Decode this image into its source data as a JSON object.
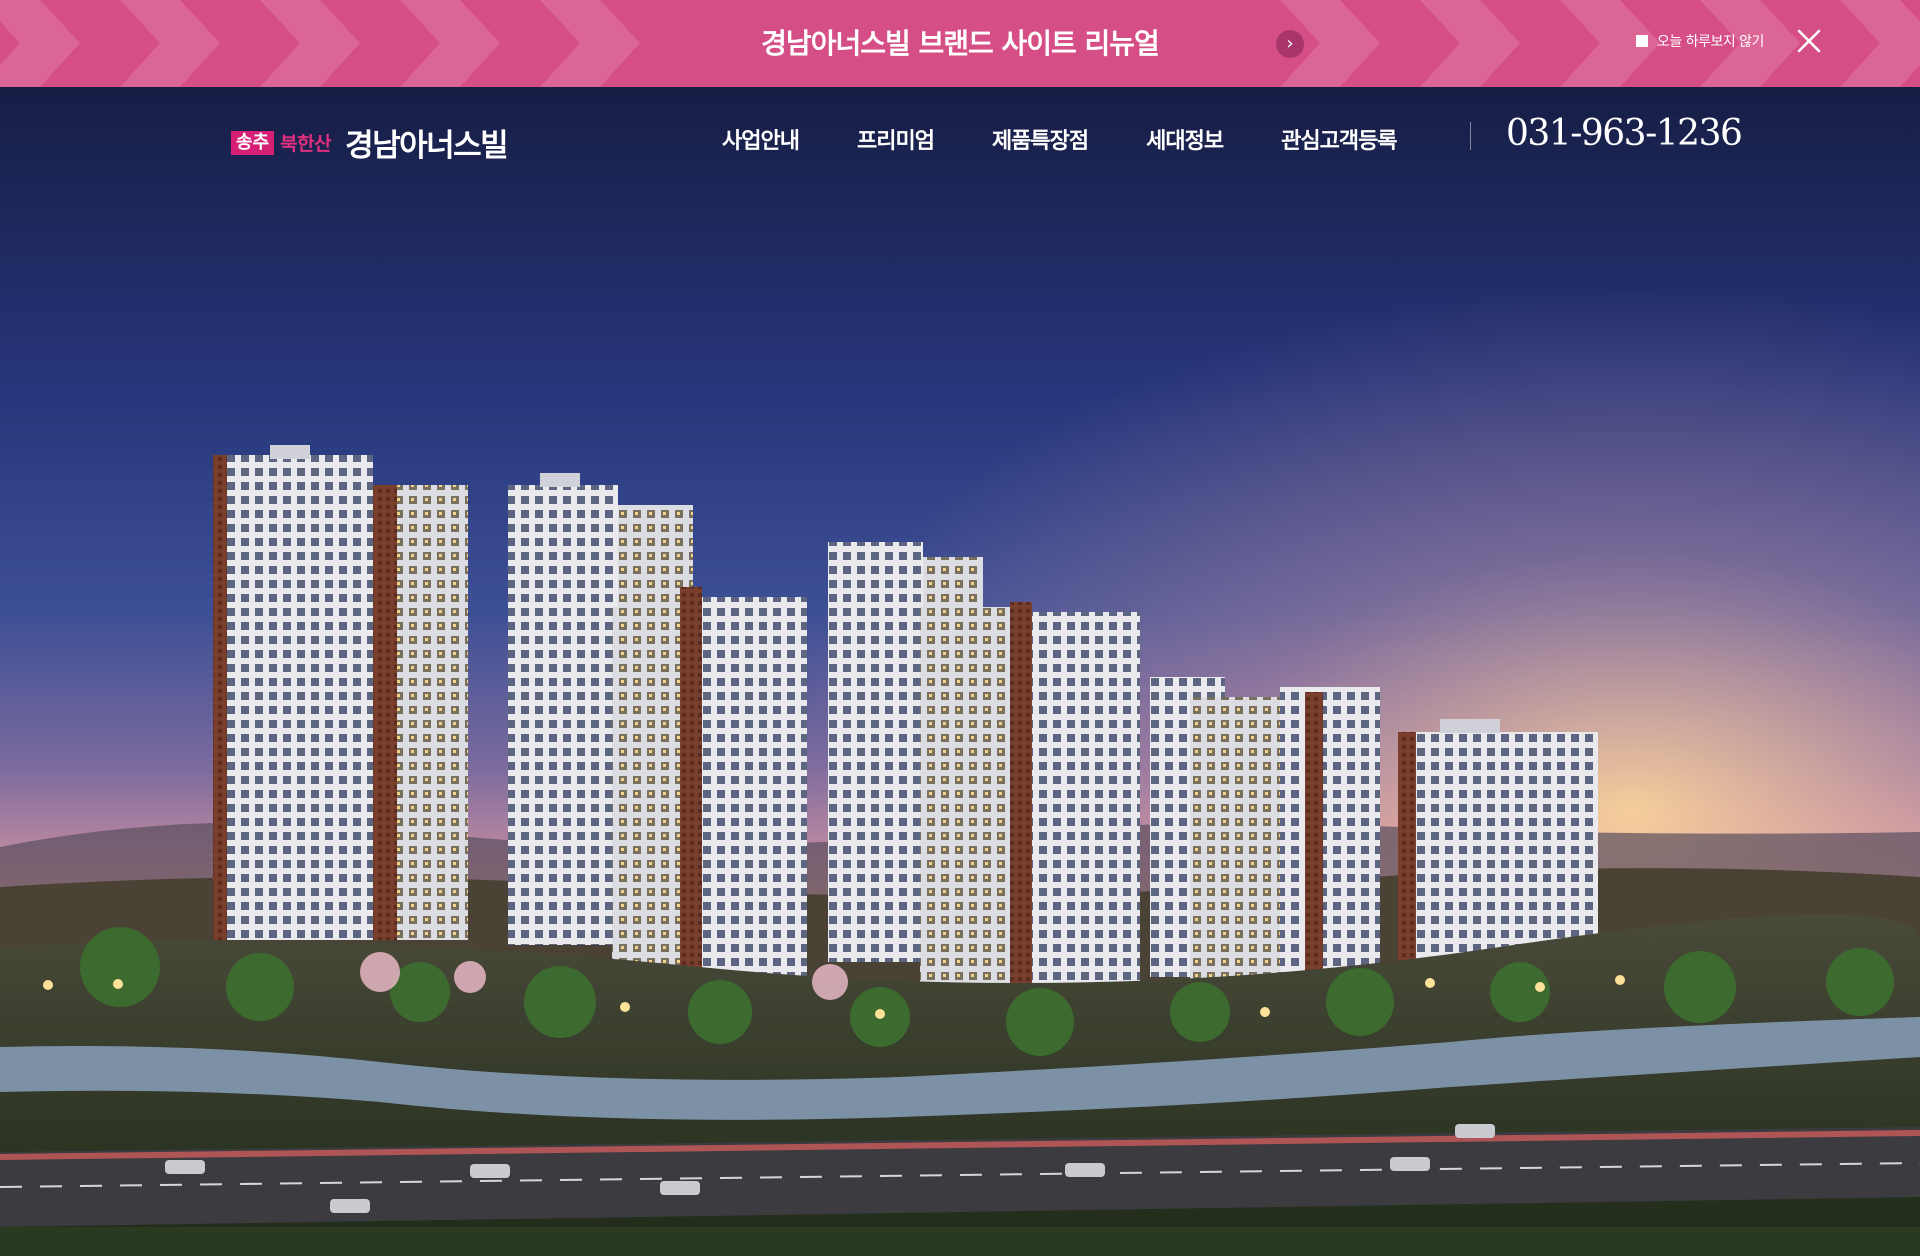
{
  "promo_banner": {
    "title": "경남아너스빌 브랜드 사이트 리뉴얼",
    "arrow_icon": "chevron-right-icon",
    "skip_today_label": "오늘 하루보지 않기",
    "close_icon": "close-icon",
    "background_color": "#d54f86"
  },
  "header": {
    "logo": {
      "badge": "송추",
      "subtitle": "북한산",
      "brand": "경남아너스빌"
    },
    "nav": [
      {
        "label": "사업안내"
      },
      {
        "label": "프리미엄"
      },
      {
        "label": "제품특장점"
      },
      {
        "label": "세대정보"
      },
      {
        "label": "관심고객등록"
      }
    ],
    "phone": "031-963-1236"
  },
  "hero": {
    "image": "apartment-complex-rendering"
  },
  "colors": {
    "brand_pink": "#d41f75",
    "text_white": "#ffffff"
  }
}
